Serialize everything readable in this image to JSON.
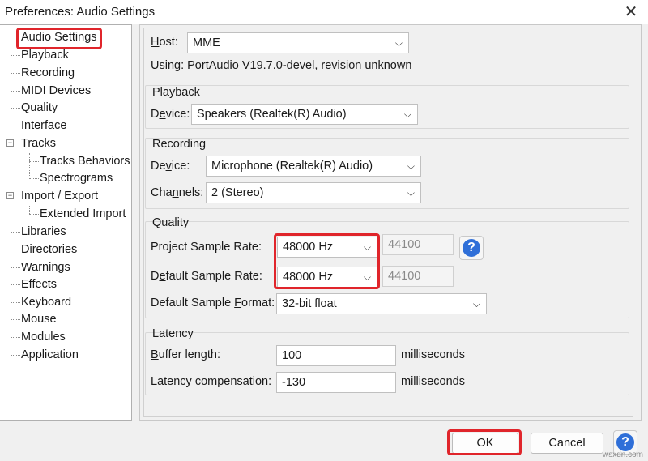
{
  "window": {
    "title": "Preferences: Audio Settings",
    "close_glyph": "✕"
  },
  "tree": {
    "items": [
      {
        "label": "Audio Settings",
        "selected": true
      },
      {
        "label": "Playback"
      },
      {
        "label": "Recording"
      },
      {
        "label": "MIDI Devices"
      },
      {
        "label": "Quality"
      },
      {
        "label": "Interface"
      },
      {
        "label": "Tracks",
        "expander": "⊟"
      },
      {
        "label": "Tracks Behaviors"
      },
      {
        "label": "Spectrograms"
      },
      {
        "label": "Import / Export",
        "expander": "⊟"
      },
      {
        "label": "Extended Import"
      },
      {
        "label": "Libraries"
      },
      {
        "label": "Directories"
      },
      {
        "label": "Warnings"
      },
      {
        "label": "Effects"
      },
      {
        "label": "Keyboard"
      },
      {
        "label": "Mouse"
      },
      {
        "label": "Modules"
      },
      {
        "label": "Application"
      }
    ]
  },
  "host": {
    "label_u": "H",
    "label_rest": "ost:",
    "value": "MME",
    "using": "Using: PortAudio V19.7.0-devel, revision unknown"
  },
  "playback": {
    "title": "Playback",
    "device_label_pre": "D",
    "device_label_u": "e",
    "device_label_rest": "vice:",
    "device_value": "Speakers (Realtek(R) Audio)"
  },
  "recording": {
    "title": "Recording",
    "device_label_pre": "De",
    "device_label_u": "v",
    "device_label_rest": "ice:",
    "device_value": "Microphone (Realtek(R) Audio)",
    "channels_label_pre": "Cha",
    "channels_label_u": "n",
    "channels_label_rest": "nels:",
    "channels_value": "2 (Stereo)"
  },
  "quality": {
    "title": "Quality",
    "project_label_pre": "Project Sample Rate:",
    "project_value": "48000 Hz",
    "project_other": "44100",
    "default_label_pre": "D",
    "default_label_u": "e",
    "default_label_rest": "fault Sample Rate:",
    "default_value": "48000 Hz",
    "default_other": "44100",
    "format_label_pre": "Default Sample ",
    "format_label_u": "F",
    "format_label_rest": "ormat:",
    "format_value": "32-bit float"
  },
  "latency": {
    "title": "Latency",
    "buffer_label_u": "B",
    "buffer_label_rest": "uffer length:",
    "buffer_value": "100",
    "buffer_unit": "milliseconds",
    "comp_label_u": "L",
    "comp_label_rest": "atency compensation:",
    "comp_value": "-130",
    "comp_unit": "milliseconds"
  },
  "footer": {
    "ok_label": "OK",
    "cancel_label": "Cancel"
  },
  "help_glyph": "?",
  "dropdown_glyph": "⌵",
  "watermark": "wsxdn.com",
  "colors": {
    "highlight": "#e0252b",
    "help_blue": "#2f6fd8"
  }
}
